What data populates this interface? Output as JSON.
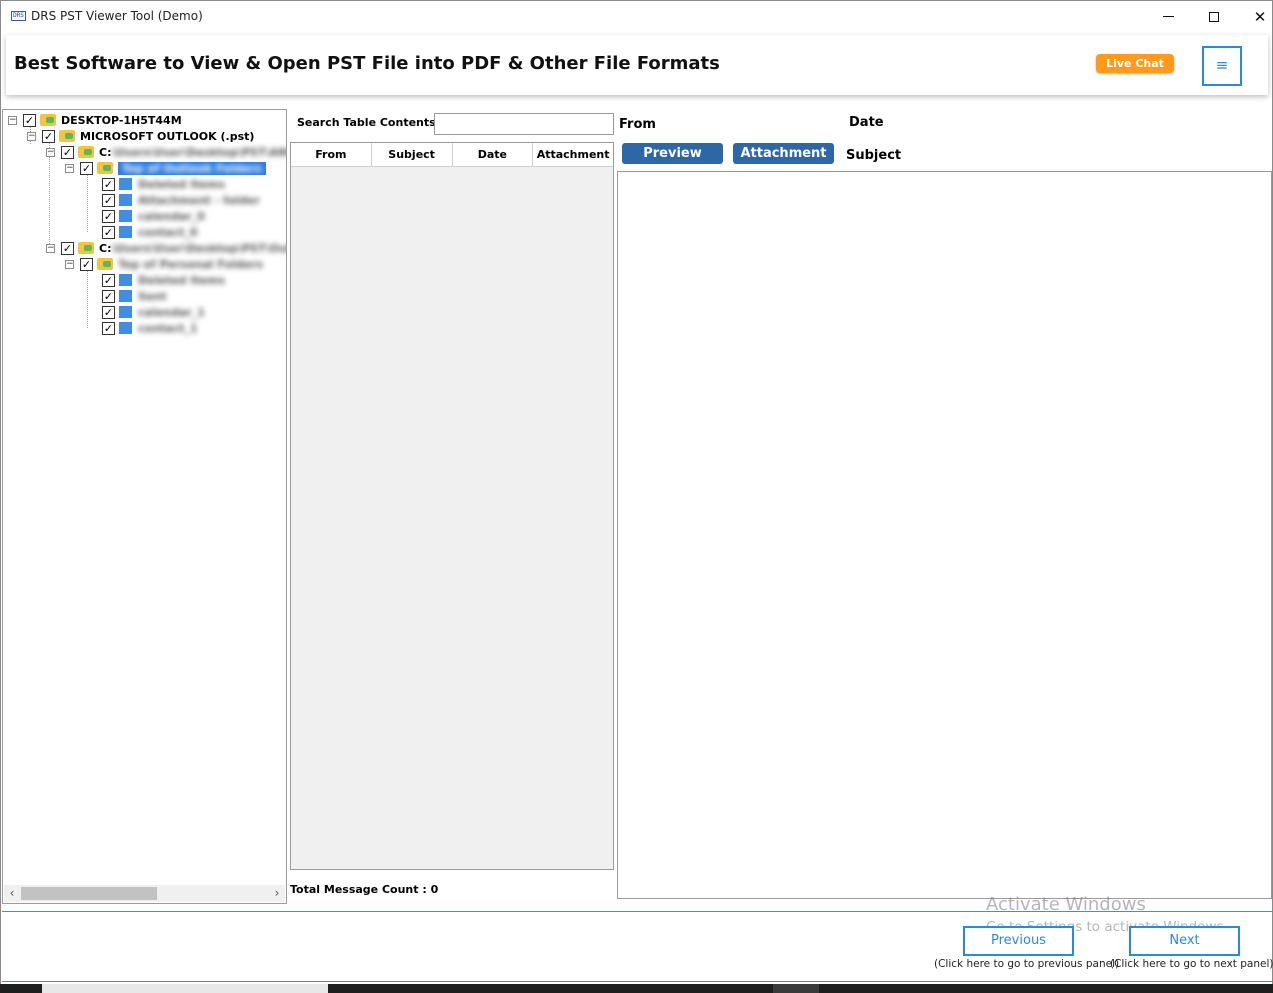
{
  "window": {
    "title": "DRS PST Viewer Tool (Demo)",
    "icon_label": "DRS",
    "close_glyph": "✕"
  },
  "header": {
    "title": "Best Software to View & Open PST File into PDF & Other File Formats",
    "live_chat_label": "Live Chat",
    "menu_glyph": "≡"
  },
  "tree": {
    "root_label": "DESKTOP-1H5T44M",
    "outlook_label": "MICROSOFT OUTLOOK (.pst)",
    "drive_label": "C:",
    "blurred_path_1": "\\Users\\User\\Desktop\\PST\\ANS",
    "selected_folder": "Top of Outlook Folders",
    "folders_1": [
      "Deleted Items",
      "Attachment - folder",
      "calendar_0",
      "contact_0"
    ],
    "blurred_path_2": "\\Users\\User\\Desktop\\PST\\Out",
    "top_folder_2": "Top of Personal Folders",
    "folders_2": [
      "Deleted Items",
      "Sent",
      "calendar_1",
      "contact_1"
    ],
    "check_glyph": "✓",
    "collapse_glyph": "−"
  },
  "search": {
    "label": "Search Table Contents:",
    "value": "",
    "placeholder": ""
  },
  "table": {
    "columns": [
      "From",
      "Subject",
      "Date",
      "Attachment"
    ],
    "total_label": "Total Message Count : 0"
  },
  "detail": {
    "from_label": "From",
    "date_label": "Date",
    "subject_label": "Subject",
    "preview_tab": "Preview",
    "attachment_tab": "Attachment"
  },
  "navigation": {
    "previous_label": "Previous",
    "previous_hint": "(Click here to go to previous panel)",
    "next_label": "Next",
    "next_hint": "(Click here to go to next panel)"
  },
  "watermark": {
    "line1": "Activate Windows",
    "line2": "Go to Settings to activate Windows."
  },
  "colors": {
    "accent_blue": "#2e67a8",
    "live_chat_orange": "#ff9a1a",
    "border_blue": "#2a8ad8"
  }
}
